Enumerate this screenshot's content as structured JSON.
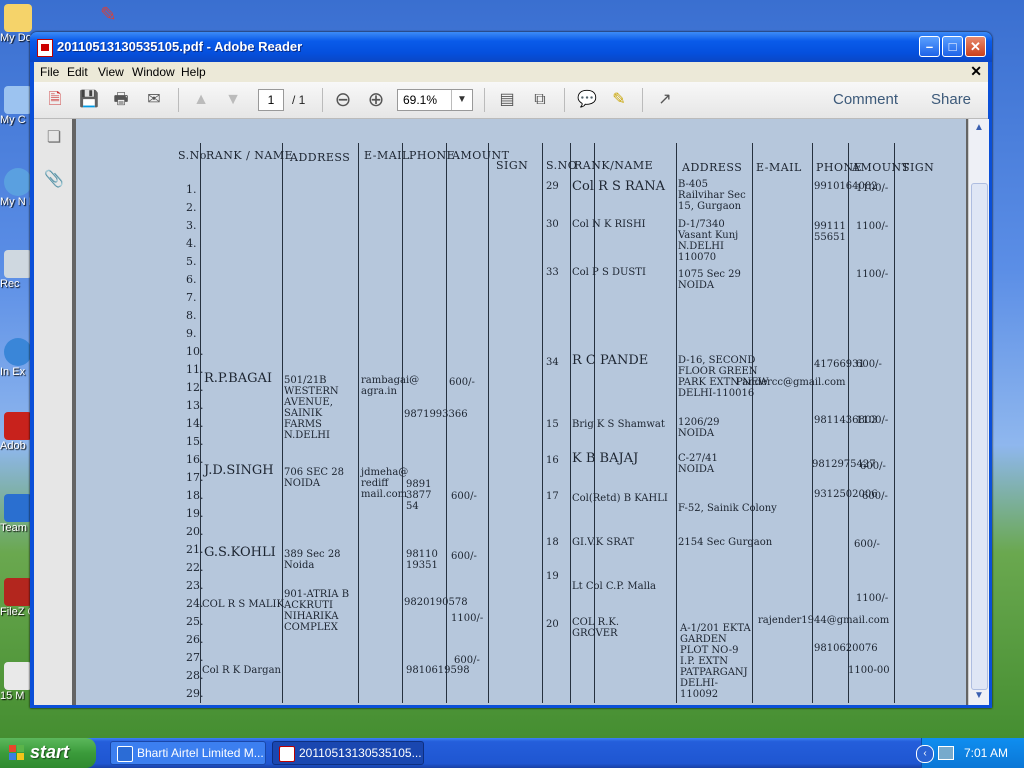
{
  "desktop": {
    "icons": [
      {
        "label": "My Do",
        "name": "my-documents-icon"
      },
      {
        "label": "My C",
        "name": "my-computer-icon"
      },
      {
        "label": "My N P",
        "name": "my-network-places-icon"
      },
      {
        "label": "Rec",
        "name": "recycle-bin-icon"
      },
      {
        "label": "In Ex",
        "name": "internet-explorer-icon"
      },
      {
        "label": "Adob",
        "name": "adobe-reader-icon"
      },
      {
        "label": "Team",
        "name": "teamviewer-icon"
      },
      {
        "label": "FileZ C",
        "name": "filezilla-icon"
      },
      {
        "label": "15 M",
        "name": "file-icon"
      }
    ]
  },
  "window": {
    "title": "20110513130535105.pdf - Adobe Reader",
    "menu": [
      "File",
      "Edit",
      "View",
      "Window",
      "Help"
    ],
    "toolbar": {
      "page_current": "1",
      "page_total": "/ 1",
      "zoom": "69.1%",
      "comment": "Comment",
      "share": "Share"
    }
  },
  "document": {
    "headers_left": [
      "S.No",
      "RANK / NAME",
      "ADDRESS",
      "E-MAIL",
      "PHONE",
      "AMOUNT",
      "SIGN"
    ],
    "headers_right": [
      "S.NO",
      "RANK/NAME",
      "ADDRESS",
      "E-MAIL",
      "PHONE",
      "AMOUNT",
      "SIGN"
    ],
    "row_numbers": [
      "1.",
      "2.",
      "3.",
      "4.",
      "5.",
      "6.",
      "7.",
      "8.",
      "9.",
      "10.",
      "11.",
      "12.",
      "13.",
      "14.",
      "15.",
      "16.",
      "17.",
      "18.",
      "19.",
      "20.",
      "21.",
      "22.",
      "23.",
      "24.",
      "25.",
      "26.",
      "27.",
      "28.",
      "29."
    ],
    "left_entries": [
      {
        "name": "R.P.BAGAI",
        "address": "501/21B WESTERN AVENUE, SAINIK FARMS N.DELHI",
        "email": "rambagai@ agra.in",
        "phone": "9871993366",
        "amount": "600/-"
      },
      {
        "name": "J.D.SINGH",
        "address": "706 SEC 28 NOIDA",
        "email": "jdmeha@ rediff mail.com",
        "phone": "9891 3877 54",
        "amount": "600/-"
      },
      {
        "name": "G.S.KOHLI",
        "address": "389 Sec 28 Noida",
        "email": "",
        "phone": "98110 19351",
        "amount": "600/-"
      },
      {
        "name": "COL R S MALIK",
        "address": "901-ATRIA B ACKRUTI NIHARIKA COMPLEX",
        "email": "",
        "phone": "9820190578",
        "amount": "1100/-"
      },
      {
        "name": "Col R K Dargan",
        "address": "",
        "email": "",
        "phone": "9810619598",
        "amount": "600/-"
      }
    ],
    "right_entries": [
      {
        "no": "29",
        "name": "Col R S RANA",
        "address": "B-405 Railvihar Sec 15, Gurgaon",
        "phone": "9910164082",
        "amount": "1100/-"
      },
      {
        "no": "30",
        "name": "Col N K RISHI",
        "address": "D-1/7340 Vasant Kunj N.DELHI 110070",
        "phone": "99111 55651",
        "amount": "1100/-"
      },
      {
        "no": "33",
        "name": "Col P S DUSTI",
        "address": "1075 Sec 29 NOIDA",
        "phone": "",
        "amount": "1100/-"
      },
      {
        "no": "34",
        "name": "R C PANDE",
        "address": "D-16, SECOND FLOOR GREEN PARK EXTN NEW DELHI-110016",
        "email": "Pandercc@gmail.com",
        "phone": "41766931",
        "amount": "600/-"
      },
      {
        "no": "15",
        "name": "Brig K S Shamwat",
        "address": "1206/29 NOIDA",
        "phone": "9811436803",
        "amount": "1100/-"
      },
      {
        "no": "16",
        "name": "K B BAJAJ",
        "address": "C-27/41 NOIDA",
        "phone": "9812975427",
        "amount": "600/-"
      },
      {
        "no": "17",
        "name": "Col(Retd) B KAHLI",
        "address": "F-52, Sainik Colony",
        "phone": "9312502006",
        "amount": "600/-"
      },
      {
        "no": "18",
        "name": "GI.V.K SRAT",
        "address": "2154 Sec Gurgaon",
        "phone": "",
        "amount": "600/-"
      },
      {
        "no": "19",
        "name": "Lt Col C.P. Malla",
        "address": "",
        "phone": "",
        "amount": "1100/-"
      },
      {
        "no": "20",
        "name": "COL R.K. GROVER",
        "address": "A-1/201 EKTA GARDEN PLOT NO-9 I.P. EXTN PATPARGANJ DELHI-110092",
        "email": "rajender1944@gmail.com",
        "phone": "9810620076",
        "amount": "1100-00"
      }
    ]
  },
  "taskbar": {
    "start": "start",
    "tasks": [
      {
        "label": "Bharti Airtel Limited M...",
        "name": "task-bharti-airtel"
      },
      {
        "label": "20110513130535105...",
        "name": "task-adobe-reader"
      }
    ],
    "clock": "7:01 AM"
  },
  "colors": {
    "titlebar": "#0550dd",
    "page_background": "#b6c7dc",
    "taskbar": "#245edb",
    "start_button": "#3b9b3b"
  }
}
